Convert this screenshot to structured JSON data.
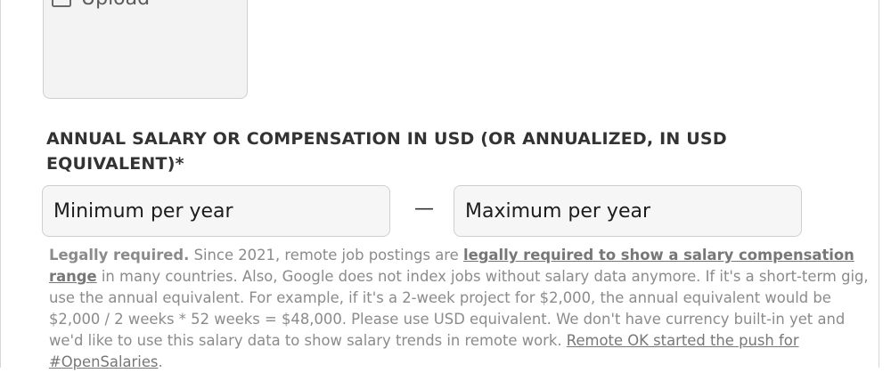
{
  "upload": {
    "label": "Upload",
    "icon": "upload-icon"
  },
  "salary": {
    "label": "ANNUAL SALARY OR COMPENSATION IN USD (OR ANNUALIZED, IN USD EQUIVALENT)*",
    "min_placeholder": "Minimum per year",
    "min_value": "",
    "separator": "—",
    "max_placeholder": "Maximum per year",
    "max_value": ""
  },
  "help": {
    "lead": "Legally required.",
    "text1": " Since 2021, remote job postings are ",
    "link1": "legally required to show a salary compensation range",
    "text2": " in many countries. Also, Google does not index jobs without salary data anymore. If it's a short-term gig, use the annual equivalent. For example, if it's a 2-week project for $2,000, the annual equivalent would be $2,000 / 2 weeks * 52 weeks = $48,000. Please use USD equivalent. We don't have currency built-in yet and we'd like to use this salary data to show salary trends in remote work. ",
    "link2": "Remote OK started the push for #OpenSalaries",
    "text3": "."
  }
}
